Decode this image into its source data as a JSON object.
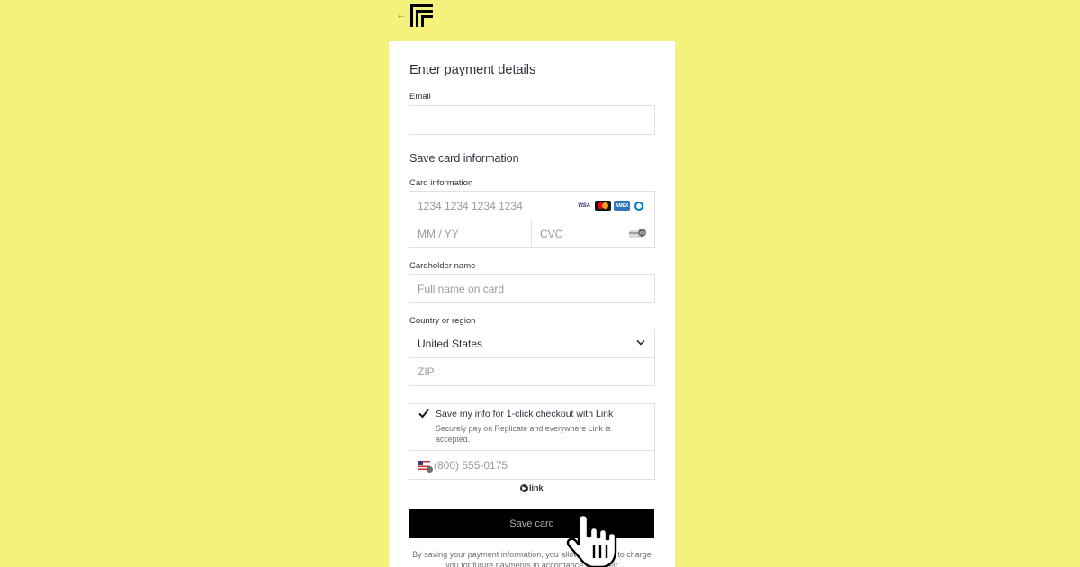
{
  "header": {
    "back_icon": "arrow-left-icon",
    "logo": "replicate-logo"
  },
  "form": {
    "title": "Enter payment details",
    "email_label": "Email",
    "email_value": "",
    "section_title": "Save card information",
    "card_label": "Card information",
    "card_number_placeholder": "1234 1234 1234 1234",
    "card_brands": [
      "VISA",
      "Mastercard",
      "AMEX",
      "Diners"
    ],
    "expiry_placeholder": "MM / YY",
    "cvc_placeholder": "CVC",
    "cvc_badge": "123",
    "cardholder_label": "Cardholder name",
    "cardholder_placeholder": "Full name on card",
    "country_label": "Country or region",
    "country_value": "United States",
    "zip_placeholder": "ZIP",
    "link_optin": {
      "checked": true,
      "title": "Save my info for 1-click checkout with Link",
      "subtitle": "Securely pay on Replicate and everywhere Link is accepted.",
      "phone_placeholder": "(800) 555-0175"
    },
    "link_brand": "link",
    "submit_label": "Save card",
    "legal_text": "By saving your payment information, you allow Replicate to charge you for future payments in accordance with their"
  },
  "colors": {
    "page_bg": "#f5f27c",
    "button_bg": "#000000",
    "card_bg": "#ffffff"
  }
}
